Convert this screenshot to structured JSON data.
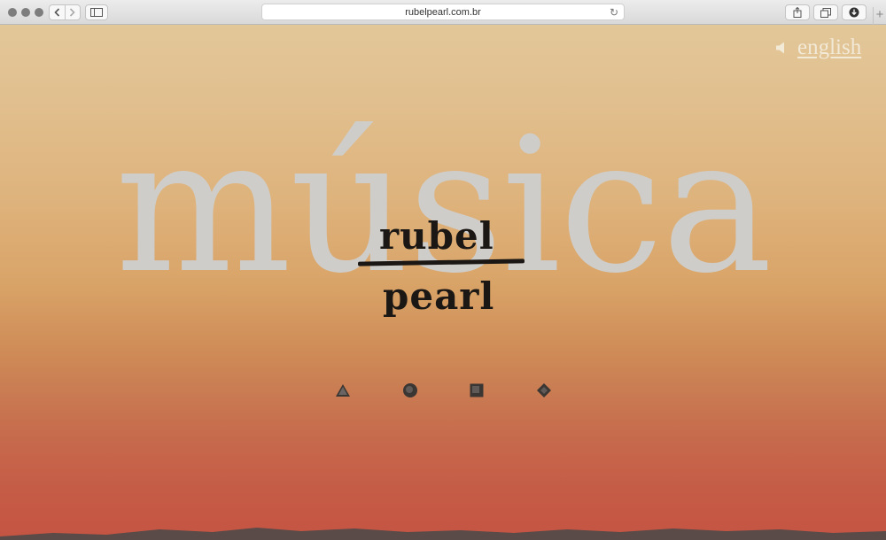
{
  "browser": {
    "url": "rubelpearl.com.br",
    "back_icon": "chevron-left-icon",
    "forward_icon": "chevron-right-icon",
    "new_tab_symbol": "+"
  },
  "page": {
    "language_link": "english",
    "background_word": "música",
    "logo": {
      "line1": "rubel",
      "line2": "pearl"
    },
    "nav_shapes": [
      "triangle-icon",
      "circle-icon",
      "square-icon",
      "diamond-icon"
    ]
  },
  "colors": {
    "sky_top": "#e2c799",
    "sky_bottom": "#c55443",
    "word_color": "#cfcdca",
    "logo_ink": "#1a1715"
  }
}
